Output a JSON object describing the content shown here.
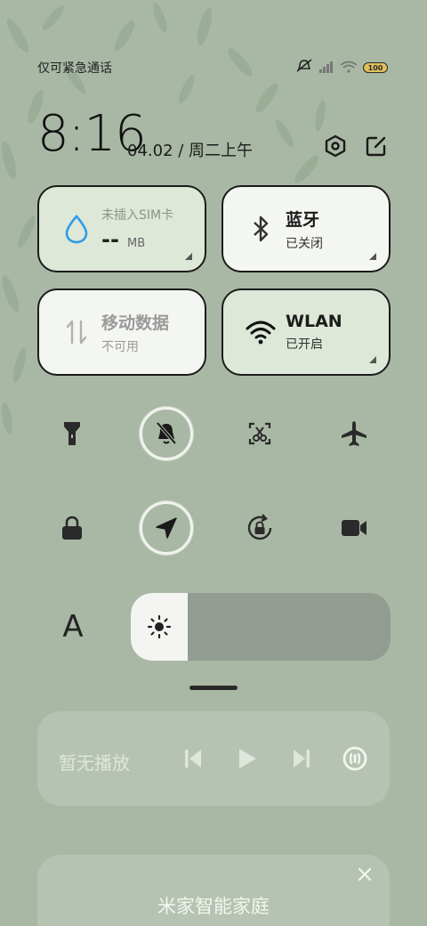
{
  "status_bar": {
    "carrier_text": "仅可紧急通话",
    "battery_label": "100"
  },
  "clock": {
    "time": "8:16",
    "date": "04.02 / 周二上午"
  },
  "tiles": {
    "data_usage": {
      "title": "未插入SIM卡",
      "value": "--",
      "unit": "MB"
    },
    "bluetooth": {
      "title": "蓝牙",
      "status": "已关闭"
    },
    "mobile_data": {
      "title": "移动数据",
      "status": "不可用"
    },
    "wlan": {
      "title": "WLAN",
      "status": "已开启"
    }
  },
  "toggles": [
    {
      "name": "flashlight",
      "icon": "flashlight-icon",
      "active": false
    },
    {
      "name": "mute",
      "icon": "bell-off-icon",
      "active": true
    },
    {
      "name": "screenshot",
      "icon": "scissors-icon",
      "active": false
    },
    {
      "name": "airplane",
      "icon": "airplane-icon",
      "active": false
    },
    {
      "name": "lock-screen",
      "icon": "lock-icon",
      "active": false
    },
    {
      "name": "location",
      "icon": "location-arrow-icon",
      "active": true
    },
    {
      "name": "rotation-lock",
      "icon": "rotation-lock-icon",
      "active": false
    },
    {
      "name": "screen-record",
      "icon": "video-camera-icon",
      "active": false
    }
  ],
  "brightness": {
    "auto_label": "A",
    "level_percent": 22
  },
  "media": {
    "title": "暂无播放"
  },
  "smart_home": {
    "title": "米家智能家庭"
  },
  "colors": {
    "background": "#a9b8a5",
    "tile_green": "#dde8d9",
    "tile_light": "#f4f6f2",
    "accent_blue": "#2f9be8"
  }
}
